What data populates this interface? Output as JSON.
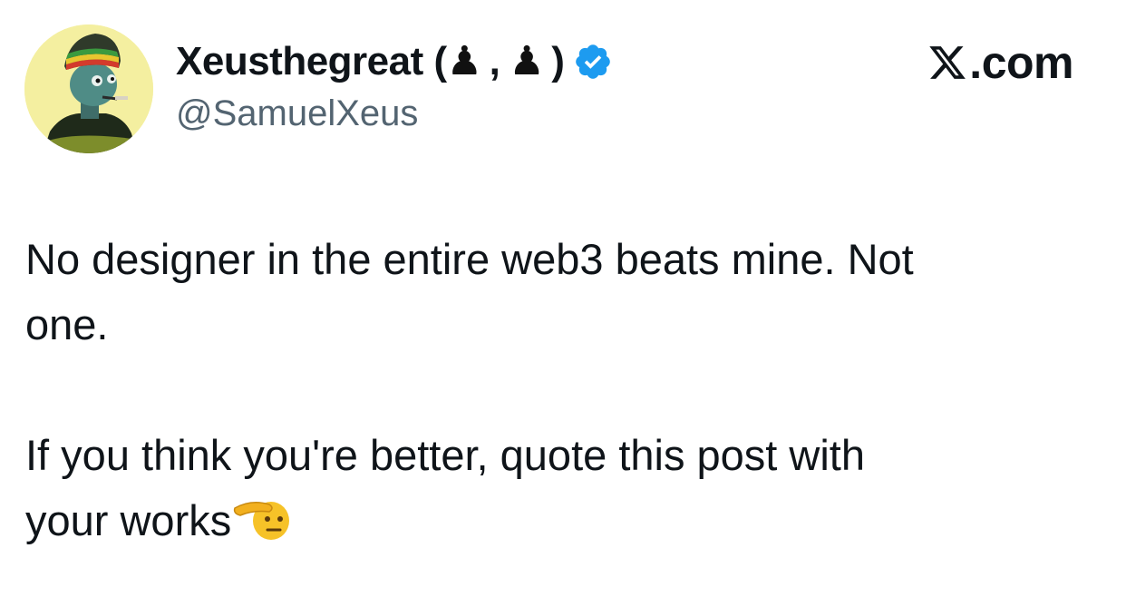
{
  "author": {
    "name": "Xeusthegreat (",
    "name_sep": ",",
    "name_close": ")",
    "name_glyph": "♟",
    "handle": "@SamuelXeus",
    "verified": true,
    "avatar": "cartoon-character-avatar",
    "accent_color": "#1d9bf0"
  },
  "brand": {
    "text": ".com",
    "logo": "x-logo-icon"
  },
  "post": {
    "line1": "No designer in the entire web3 beats mine. Not",
    "line2": "one.",
    "line3": "If you think you're better, quote this post with",
    "line4": "your works",
    "emoji": "saluting-face-emoji"
  }
}
